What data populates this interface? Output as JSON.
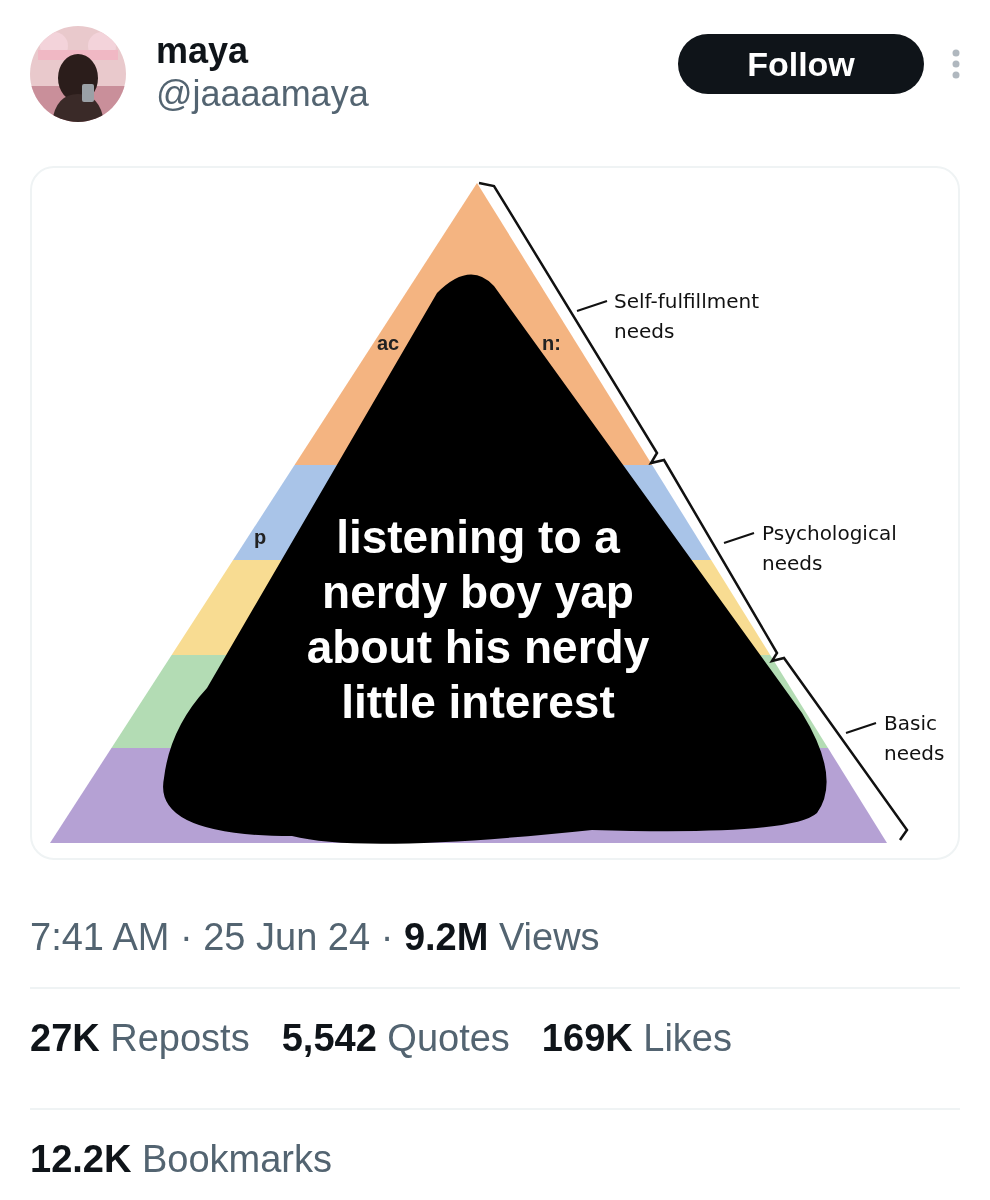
{
  "author": {
    "name": "maya",
    "handle": "@jaaaamaya"
  },
  "follow_button": "Follow",
  "media": {
    "bands": [
      {
        "color": "#f4b481"
      },
      {
        "color": "#a9c4e8"
      },
      {
        "color": "#f8dc92"
      },
      {
        "color": "#b3dcb4"
      },
      {
        "color": "#b5a1d4"
      }
    ],
    "fragments": [
      "ac",
      "n:",
      "p"
    ],
    "levels": [
      {
        "lines": [
          "Self-fulfillment",
          "needs"
        ]
      },
      {
        "lines": [
          "Psychological",
          "needs"
        ]
      },
      {
        "lines": [
          "Basic",
          "needs"
        ]
      }
    ],
    "caption": [
      "listening to a",
      "nerdy boy yap",
      "about his nerdy",
      "little interest"
    ]
  },
  "timestamp": "7:41 AM · 25 Jun 24 · **9.2M** Views",
  "stats": [
    "**27K** Reposts",
    "**5,542** Quotes",
    "**169K** Likes"
  ],
  "bookmarks": "**12.2K** Bookmarks"
}
